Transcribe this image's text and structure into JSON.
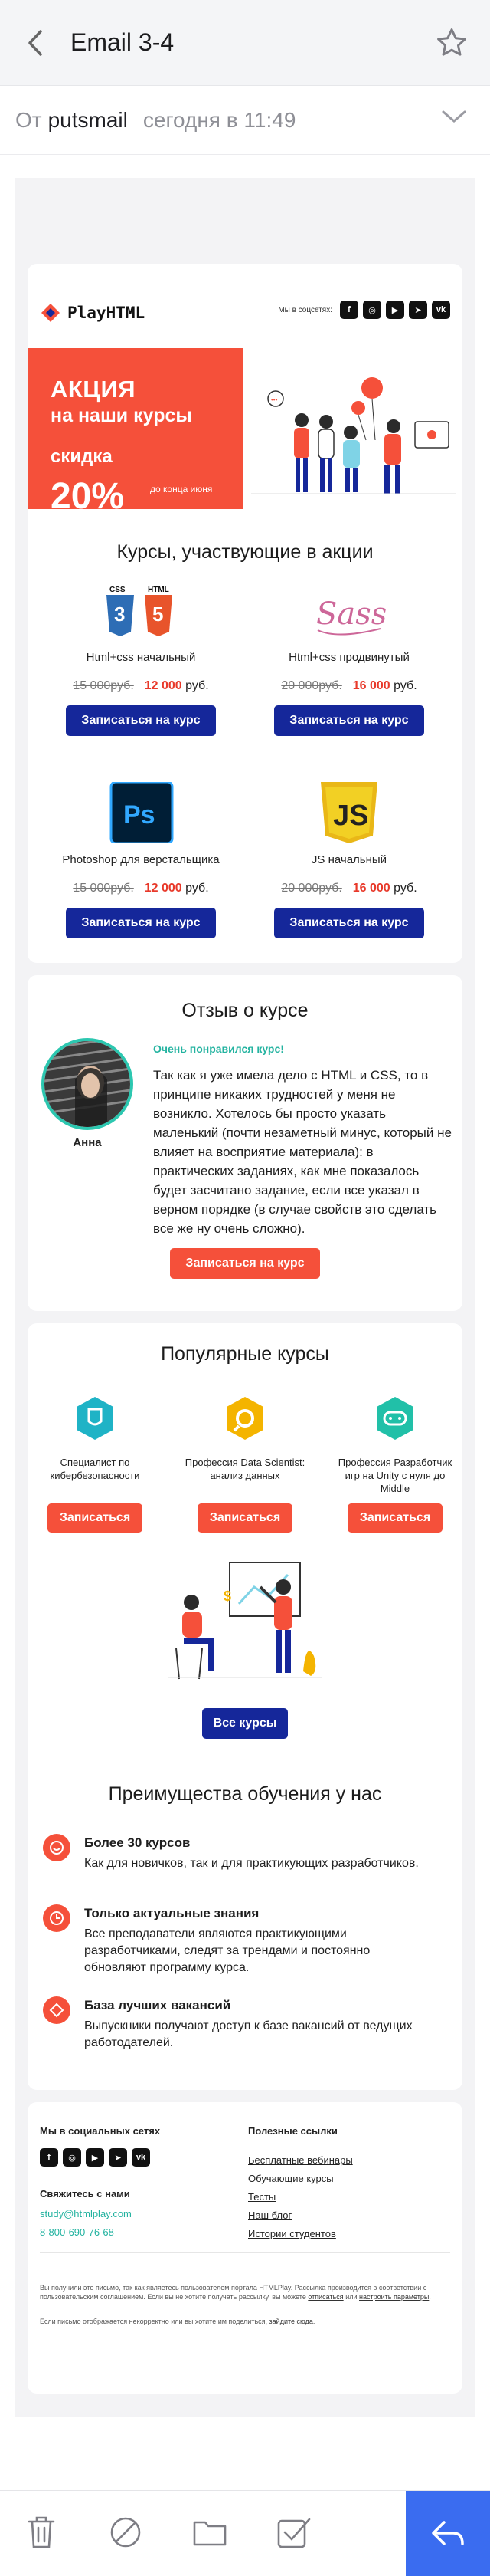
{
  "header": {
    "title": "Email 3-4"
  },
  "message": {
    "from_label": "От",
    "sender": "putsmail",
    "time": "сегодня в 11:49"
  },
  "email": {
    "logo_text": "PlayHTML",
    "social_label": "Мы в соцсетях:",
    "banner": {
      "line1": "АКЦИЯ",
      "line2": "на наши курсы",
      "line3": "скидка",
      "percent": "20%",
      "till": "до конца июня"
    },
    "courses_title": "Курсы, участвующие в акции",
    "courses": [
      {
        "name": "Html+css начальный",
        "old_price": "15 000руб.",
        "new_price": "12 000",
        "currency": "руб.",
        "button": "Записаться на курс",
        "icon": "css-html-icon"
      },
      {
        "name": "Html+css продвинутый",
        "old_price": "20 000руб.",
        "new_price": "16 000",
        "currency": "руб.",
        "button": "Записаться на курс",
        "icon": "sass-icon"
      },
      {
        "name": "Photoshop для верстальщика",
        "old_price": "15 000руб.",
        "new_price": "12 000",
        "currency": "руб.",
        "button": "Записаться на курс",
        "icon": "photoshop-icon"
      },
      {
        "name": "JS начальный",
        "old_price": "20 000руб.",
        "new_price": "16 000",
        "currency": "руб.",
        "button": "Записаться на курс",
        "icon": "js-icon"
      }
    ],
    "review": {
      "title": "Отзыв о курсе",
      "liked": "Очень понравился курс!",
      "text": "Так как я уже имела дело с HTML и CSS, то в принципе никаких трудностей у меня не возникло. Хотелось бы просто указать маленький (почти незаметный минус, который не влияет на восприятие материала): в практических заданиях, как мне показалось будет засчитано задание, если все указал в верном порядке (в случае свойств это сделать все же ну очень сложно).",
      "author": "Анна",
      "button": "Записаться на курс"
    },
    "popular": {
      "title": "Популярные курсы",
      "items": [
        {
          "name": "Специалист по кибербезопасности",
          "button": "Записаться",
          "color": "#1fb3c6"
        },
        {
          "name": "Профессия Data Scientist: анализ данных",
          "button": "Записаться",
          "color": "#f4b400"
        },
        {
          "name": "Профессия Разработчик игр на Unity с нуля до Middle",
          "button": "Записаться",
          "color": "#21c0a8"
        }
      ],
      "all_button": "Все курсы"
    },
    "advantages": {
      "title": "Преимущества обучения у нас",
      "items": [
        {
          "title": "Более 30 курсов",
          "desc": "Как для новичков, так и для практикующих разработчиков."
        },
        {
          "title": "Только актуальные знания",
          "desc": "Все преподаватели являются практикующими разработчиками, следят за трендами и постоянно обновляют программу курса."
        },
        {
          "title": "База лучших вакансий",
          "desc": "Выпускники получают доступ к базе вакансий от ведущих работодателей."
        }
      ]
    },
    "footer": {
      "social_title": "Мы в социальных сетях",
      "contact_title": "Свяжитесь с нами",
      "email": "study@htmlplay.com",
      "phone": "8-800-690-76-68",
      "links_title": "Полезные ссылки",
      "links": [
        "Бесплатные вебинары",
        "Обучающие курсы",
        "Тесты",
        "Наш блог",
        "Истории студентов"
      ],
      "legal1": "Вы получили это письмо, так как являетесь пользователем портала HTMLPlay. Рассылка производится в соответствии с пользовательским соглашением. Если вы не хотите получать рассылку, вы можете",
      "unsubscribe": "отписаться",
      "legal_or": "или",
      "settings": "настроить параметры",
      "legal2": "Если письмо отображается некорректно или вы хотите им поделиться,",
      "webview": "зайдите сюда"
    }
  },
  "colors": {
    "accent_red": "#f5503a",
    "navy": "#15279a",
    "teal": "#23b3a0",
    "reply_blue": "#3a6cf0"
  }
}
